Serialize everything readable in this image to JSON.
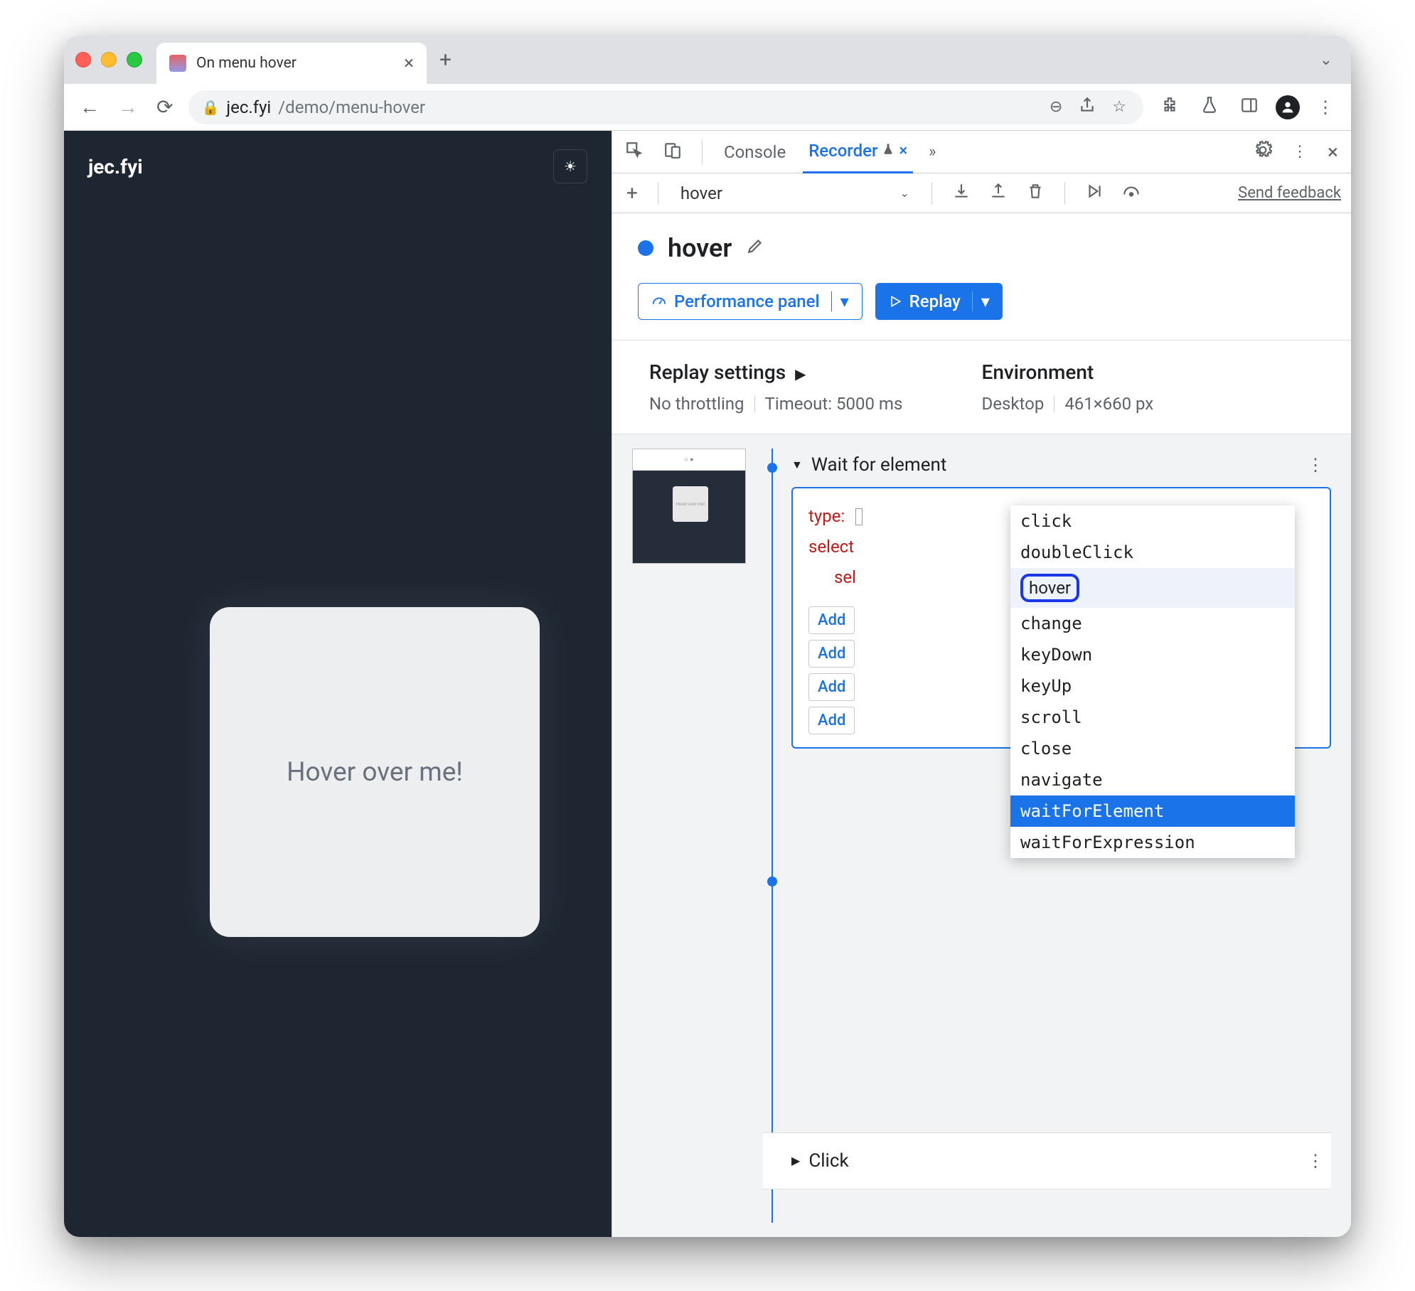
{
  "browser": {
    "tab_title": "On menu hover",
    "url_host": "jec.fyi",
    "url_path": "/demo/menu-hover"
  },
  "page": {
    "site_title": "jec.fyi",
    "card_text": "Hover over me!"
  },
  "devtools": {
    "tabs": {
      "console": "Console",
      "recorder": "Recorder"
    },
    "recording_select": "hover",
    "feedback_link": "Send feedback",
    "recording_name": "hover",
    "perf_button": "Performance panel",
    "replay_button": "Replay",
    "replay_settings_label": "Replay settings",
    "throttling": "No throttling",
    "timeout": "Timeout: 5000 ms",
    "environment_label": "Environment",
    "env_device": "Desktop",
    "env_size": "461×660 px"
  },
  "thumb_overlay": "Hover over me!",
  "step1": {
    "title": "Wait for element",
    "type_key": "type:",
    "sel_key_full": "select",
    "sel_key_trunc": "sel",
    "add_prefix": "Add"
  },
  "dropdown_options": [
    "click",
    "doubleClick",
    "hover",
    "change",
    "keyDown",
    "keyUp",
    "scroll",
    "close",
    "navigate",
    "waitForElement",
    "waitForExpression"
  ],
  "dropdown_highlight": "hover",
  "dropdown_selected": "waitForElement",
  "step2": {
    "title": "Click"
  }
}
